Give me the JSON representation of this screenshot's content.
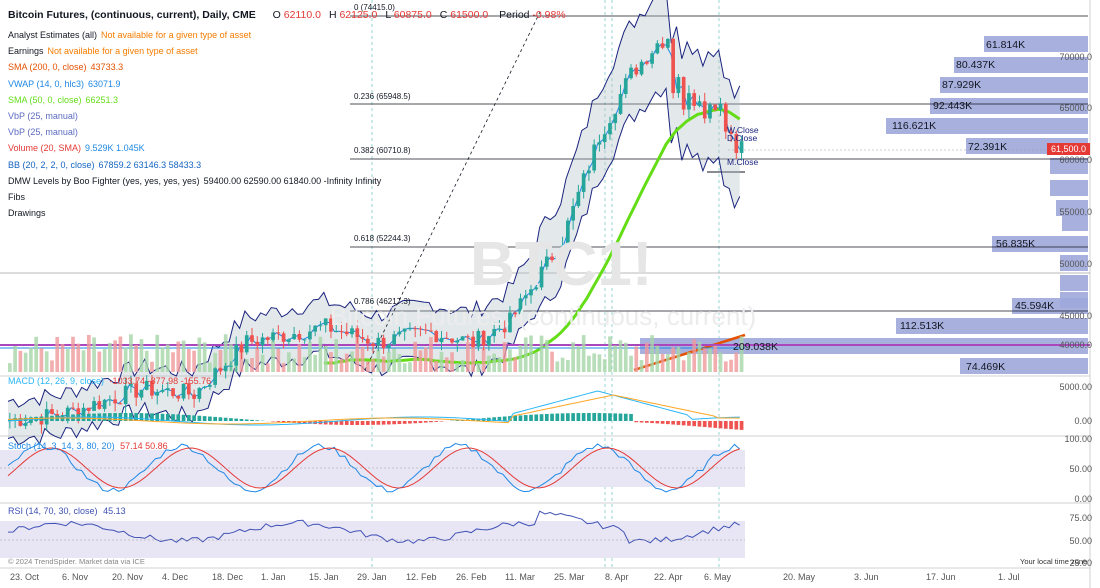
{
  "header": {
    "title": "Bitcoin Futures, (continuous, current), Daily, CME",
    "ohlc": [
      {
        "k": "O",
        "v": "62110.0"
      },
      {
        "k": "H",
        "v": "62125.0"
      },
      {
        "k": "L",
        "v": "60875.0"
      },
      {
        "k": "C",
        "v": "61500.0"
      }
    ],
    "period_label": "Period",
    "period_value": "-0.98%"
  },
  "legend": [
    {
      "name": "Analyst Estimates (all)",
      "value": "Not available for a given type of asset",
      "color": "#f57c00"
    },
    {
      "name": "Earnings",
      "value": "Not available for a given type of asset",
      "color": "#f57c00"
    },
    {
      "name": "SMA (200, 0, close)",
      "value": "43733.3",
      "color": "#e65100"
    },
    {
      "name": "VWAP (14, 0, hlc3)",
      "value": "63071.9",
      "color": "#1e88e5"
    },
    {
      "name": "SMA (50, 0, close)",
      "value": "66251.3",
      "color": "#64dd17"
    },
    {
      "name": "VbP (25, manual)",
      "value": "",
      "color": "#5c6bc0"
    },
    {
      "name": "VbP (25, manual)",
      "value": "",
      "color": "#5c6bc0"
    },
    {
      "name": "Volume (20, SMA)",
      "value": "9.529K  1.045K",
      "color": "#e53935"
    },
    {
      "name": "BB (20, 2, 2, 0, close)",
      "value": "67859.2  63146.3  58433.3",
      "color": "#1565c0"
    },
    {
      "name": "DMW Levels by Boo Fighter (yes, yes, yes, yes)",
      "value": "59400.00  62590.00  61840.00  -Infinity  Infinity",
      "color": "#131722"
    },
    {
      "name": "Fibs",
      "value": "",
      "color": "#131722"
    },
    {
      "name": "Drawings",
      "value": "",
      "color": "#131722"
    }
  ],
  "fib_levels": [
    {
      "label": "0 (74415.0)"
    },
    {
      "label": "0.236 (65948.5)"
    },
    {
      "label": "0.382 (60710.8)"
    },
    {
      "label": "0.618 (52244.3)"
    },
    {
      "label": "0.786 (46217.3)"
    }
  ],
  "vbp_labels": [
    "61.814K",
    "80.437K",
    "87.929K",
    "92.443K",
    "116.621K",
    "72.391K",
    "56.835K",
    "45.594K",
    "112.513K",
    "209.038K",
    "74.469K"
  ],
  "level_labels": [
    "W.Close",
    "D.Close",
    "M.Close"
  ],
  "price_axis": [
    "70000.0",
    "65000.0",
    "60000.0",
    "55000.0",
    "50000.0",
    "45000.0",
    "40000.0"
  ],
  "price_tag": "61,500.0",
  "macd": {
    "label": "MACD (12, 26, 9, close)",
    "values": "-1033.74  -877.98  -155.76",
    "axis": [
      "5000.00",
      "0.00"
    ]
  },
  "stoch": {
    "label": "Stoch (14, 3, 14, 3, 80, 20)",
    "values": "57.14  50.86",
    "axis": [
      "100.00",
      "50.00",
      "0.00"
    ]
  },
  "rsi": {
    "label": "RSI (14, 70, 30, close)",
    "values": "45.13",
    "axis": [
      "75.00",
      "50.00",
      "25.00"
    ]
  },
  "watermark": {
    "symbol": "BTC1!",
    "desc": "Bitcoin Futures, (continuous, current)"
  },
  "copyright": "© 2024 TrendSpider. Market data via ICE",
  "timezone": "Your local time zone",
  "x_axis": [
    "23. Oct",
    "6. Nov",
    "20. Nov",
    "4. Dec",
    "18. Dec",
    "1. Jan",
    "15. Jan",
    "29. Jan",
    "12. Feb",
    "26. Feb",
    "11. Mar",
    "25. Mar",
    "8. Apr",
    "22. Apr",
    "6. May",
    "20. May",
    "3. Jun",
    "17. Jun",
    "1. Jul"
  ],
  "colors": {
    "up": "#26a69a",
    "down": "#ef5350",
    "sma50": "#64dd17",
    "sma200": "#e65100",
    "vwap": "#1e88e5",
    "bb": "#1a237e",
    "vbp": "#9fa8da",
    "macd": "#29b6f6",
    "signal": "#ffa726",
    "stochK": "#1e88e5",
    "stochD": "#e53935",
    "rsi": "#3f51b5"
  }
}
